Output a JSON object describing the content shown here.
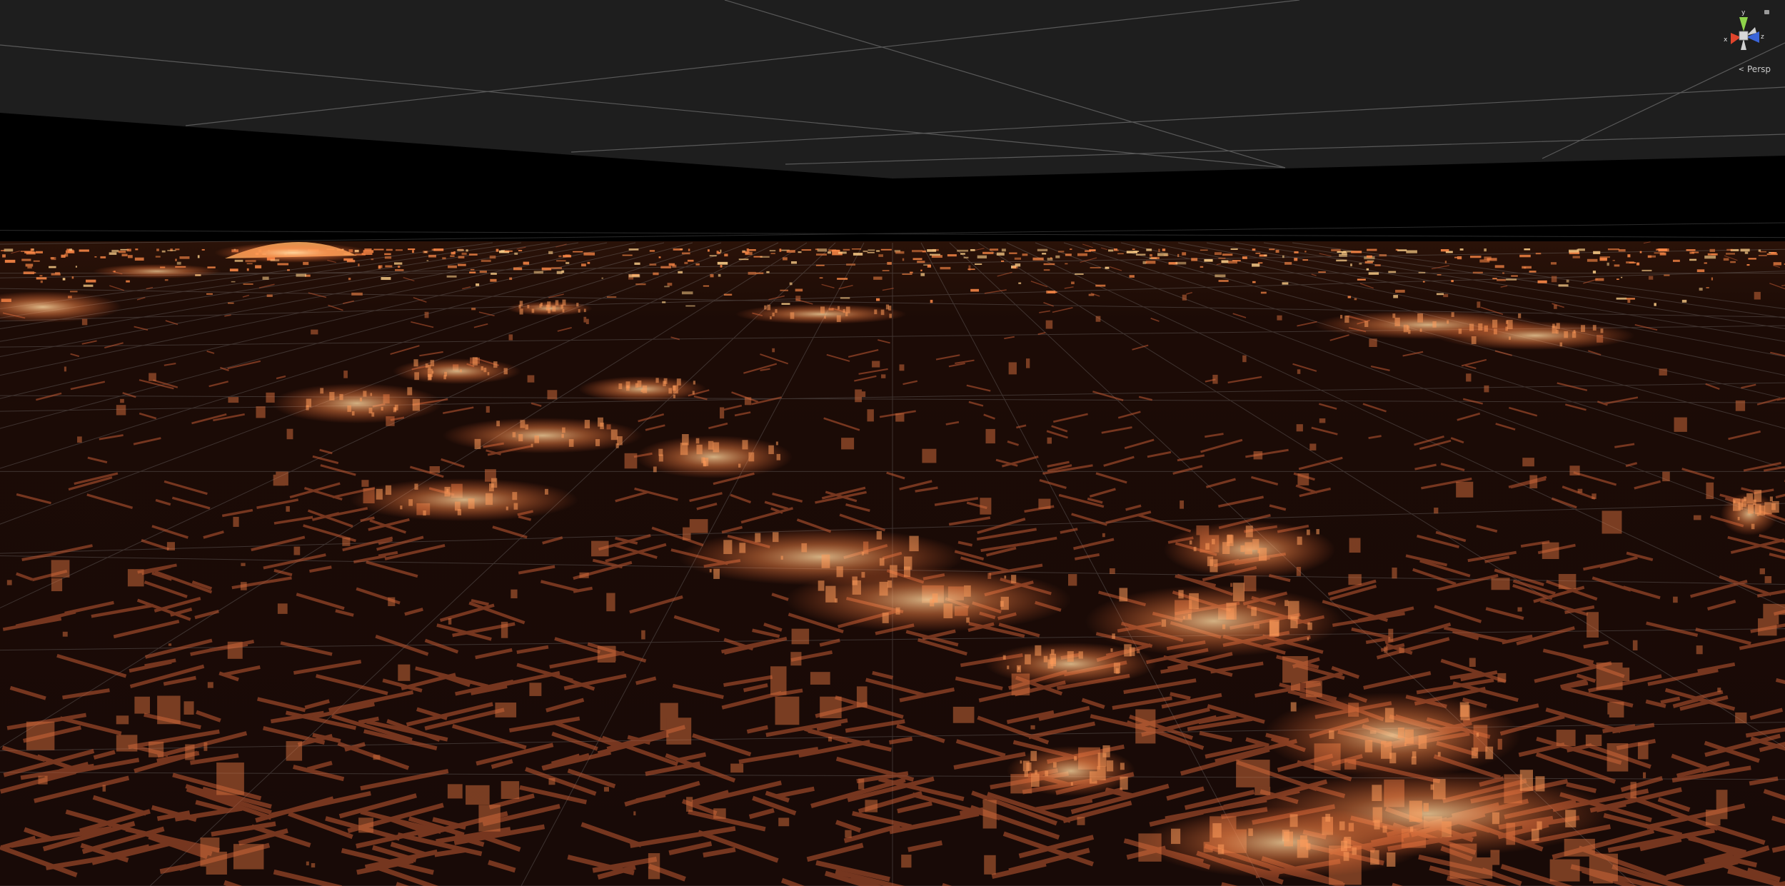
{
  "scene_view": {
    "projection_label": "Persp",
    "projection_arrow": "<",
    "axis_labels": {
      "x": "x",
      "y": "y",
      "z": "z"
    }
  },
  "colors": {
    "sky": "#1e1e1e",
    "horizon": "#000000",
    "ground": "#180a07",
    "grid_line": "#8a8a8a",
    "building_glow": "#ff8c4a",
    "building_bright": "#ffd28a",
    "gizmo_x": "#e0442c",
    "gizmo_y": "#8ed34a",
    "gizmo_z": "#3a64d8",
    "gizmo_center": "#d8d8d8"
  },
  "icons": [
    "axis-gizmo-icon",
    "lock-icon",
    "projection-arrow-icon"
  ]
}
